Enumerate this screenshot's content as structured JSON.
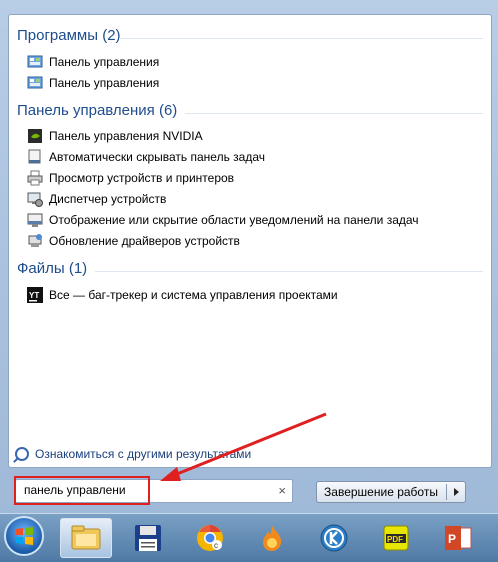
{
  "groups": [
    {
      "title": "Программы (2)",
      "items": [
        {
          "label": "Панель управления",
          "icon": "control-panel-icon"
        },
        {
          "label": "Панель управления",
          "icon": "control-panel-icon"
        }
      ]
    },
    {
      "title": "Панель управления (6)",
      "items": [
        {
          "label": "Панель управления NVIDIA",
          "icon": "nvidia-icon"
        },
        {
          "label": "Автоматически скрывать панель задач",
          "icon": "taskbar-icon"
        },
        {
          "label": "Просмотр устройств и принтеров",
          "icon": "printer-icon"
        },
        {
          "label": "Диспетчер устройств",
          "icon": "device-manager-icon"
        },
        {
          "label": "Отображение или скрытие области уведомлений на панели задач",
          "icon": "notification-area-icon"
        },
        {
          "label": "Обновление драйверов устройств",
          "icon": "driver-update-icon"
        }
      ]
    },
    {
      "title": "Файлы (1)",
      "items": [
        {
          "label": "Все — баг-трекер и система управления проектами",
          "icon": "youtrack-icon"
        }
      ]
    }
  ],
  "more_results": "Ознакомиться с другими результатами",
  "search": {
    "value": "панель управлени",
    "clear": "×"
  },
  "shutdown_label": "Завершение работы",
  "taskbar": {
    "pinned": [
      {
        "name": "explorer-icon",
        "active": true
      },
      {
        "name": "floppy-save-icon",
        "active": false
      },
      {
        "name": "chrome-canary-icon",
        "active": false
      },
      {
        "name": "fire-app-icon",
        "active": false
      },
      {
        "name": "round-k-app-icon",
        "active": false
      },
      {
        "name": "pdf-reader-icon",
        "active": false
      },
      {
        "name": "powerpoint-icon",
        "active": false
      }
    ]
  },
  "colors": {
    "accent": "#1e4d8c",
    "highlight": "#e02020"
  }
}
